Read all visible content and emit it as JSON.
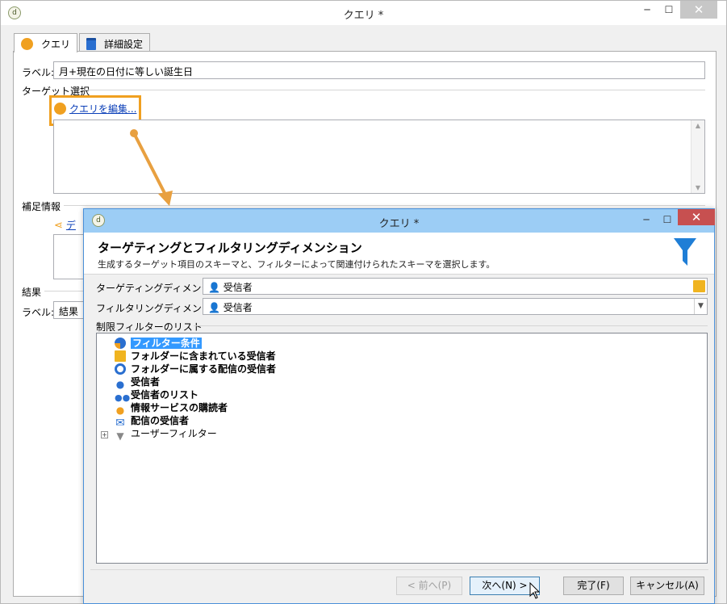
{
  "main_window": {
    "title": "クエリ *",
    "controls": {
      "minimize": "─",
      "maximize": "☐",
      "close": "✕"
    },
    "tabs": [
      {
        "label": "クエリ",
        "icon": "orange-circle-icon"
      },
      {
        "label": "詳細設定",
        "icon": "clipboard-icon"
      }
    ],
    "label_field": {
      "label": "ラベル:",
      "value": "月+現在の日付に等しい誕生日"
    },
    "target_section": {
      "heading": "ターゲット選択",
      "edit_link": "クエリを編集..."
    },
    "supplement_section": {
      "heading": "補足情報",
      "link": "デ"
    },
    "result_section": {
      "heading": "結果",
      "label": "ラベル:",
      "value": "結果"
    }
  },
  "dialog": {
    "title": "クエリ *",
    "controls": {
      "minimize": "─",
      "maximize": "☐",
      "close": "✕"
    },
    "header_title": "ターゲティングとフィルタリングディメンション",
    "header_subtitle": "生成するターゲット項目のスキーマと、フィルターによって関連付けられたスキーマを選択します。",
    "targeting_label": "ターゲティングディメンション:",
    "targeting_value": "受信者",
    "filtering_label": "フィルタリングディメンション:",
    "filtering_value": "受信者",
    "filter_list_heading": "制限フィルターのリスト",
    "filter_items": [
      {
        "label": "フィルター条件",
        "icon": "filter-condition-icon",
        "selected": true
      },
      {
        "label": "フォルダーに含まれている受信者",
        "icon": "folder-recipients-icon"
      },
      {
        "label": "フォルダーに属する配信の受信者",
        "icon": "delivery-recipients-icon"
      },
      {
        "label": "受信者",
        "icon": "recipient-icon"
      },
      {
        "label": "受信者のリスト",
        "icon": "recipient-list-icon"
      },
      {
        "label": "情報サービスの購読者",
        "icon": "subscriber-icon"
      },
      {
        "label": "配信の受信者",
        "icon": "envelope-icon"
      },
      {
        "label": "ユーザーフィルター",
        "icon": "user-filter-icon",
        "expandable": true
      }
    ],
    "buttons": {
      "prev": "< 前へ(P)",
      "next": "次へ(N) >",
      "finish": "完了(F)",
      "cancel": "キャンセル(A)"
    }
  },
  "colors": {
    "accent_orange": "#f0a020",
    "dialog_titlebar": "#9ccdf5",
    "link": "#0b3fb8",
    "selection": "#3399ff"
  }
}
